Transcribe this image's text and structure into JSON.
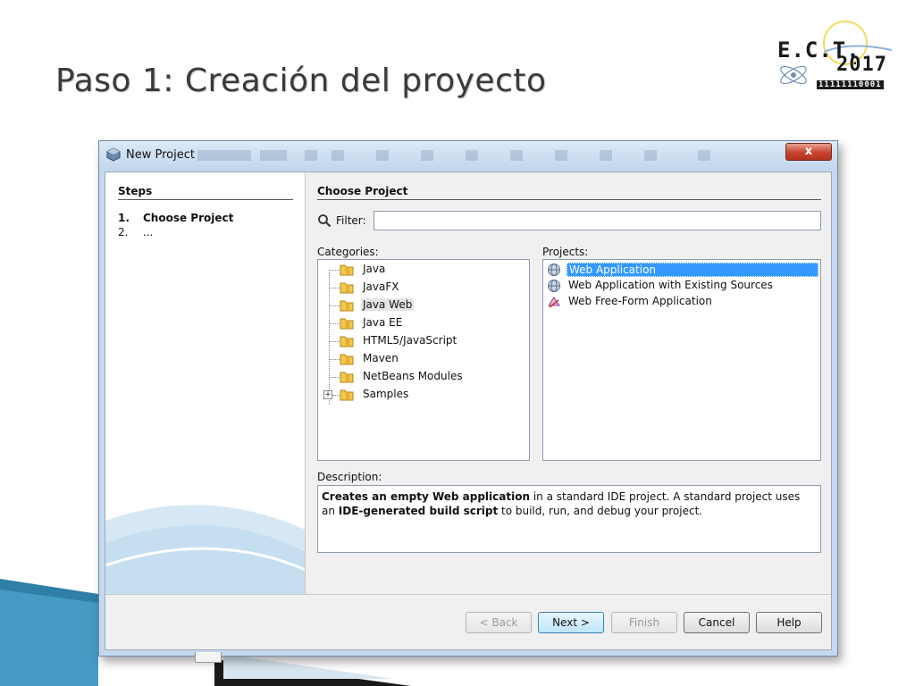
{
  "slide": {
    "title": "Paso 1: Creación del proyecto"
  },
  "logo": {
    "main": "E.C.T.",
    "year": "2017",
    "bits": "11111110001"
  },
  "dialog": {
    "title": "New Project",
    "close_label": "x",
    "steps": {
      "heading": "Steps",
      "items": [
        {
          "num": "1.",
          "label": "Choose Project"
        },
        {
          "num": "2.",
          "label": "..."
        }
      ]
    },
    "choose_heading": "Choose Project",
    "filter": {
      "label": "Filter:",
      "value": "",
      "placeholder": ""
    },
    "categories": {
      "label": "Categories:",
      "items": [
        "Java",
        "JavaFX",
        "Java Web",
        "Java EE",
        "HTML5/JavaScript",
        "Maven",
        "NetBeans Modules",
        "Samples"
      ],
      "selected": "Java Web"
    },
    "projects": {
      "label": "Projects:",
      "items": [
        "Web Application",
        "Web Application with Existing Sources",
        "Web Free-Form Application"
      ],
      "selected": "Web Application"
    },
    "description": {
      "label": "Description:",
      "part1_bold": "Creates an empty Web application",
      "part2": " in a standard IDE project. A standard project uses an ",
      "part3_bold": "IDE-generated build script",
      "part4": " to build, run, and debug your project."
    },
    "buttons": {
      "back": "< Back",
      "next": "Next >",
      "finish": "Finish",
      "cancel": "Cancel",
      "help": "Help"
    }
  },
  "colors": {
    "selection": "#3399ff",
    "window_frame": "#c5d9ee",
    "close_button": "#c7432d"
  }
}
